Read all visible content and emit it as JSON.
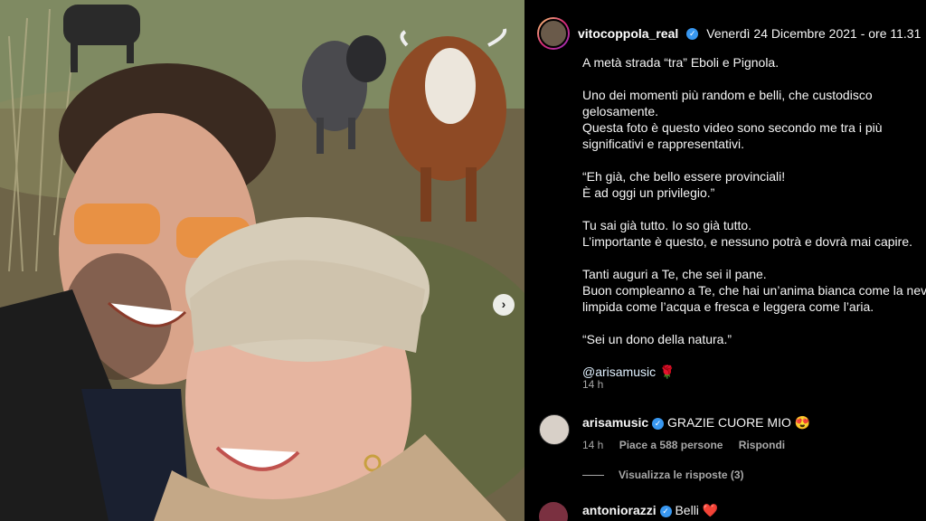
{
  "post": {
    "username": "vitocoppola_real",
    "datetime": "Venerdì 24 Dicembre 2021 - ore 11.31",
    "caption_lines": [
      [
        "A metà strada “tra” Eboli e Pignola."
      ],
      [
        "Uno dei momenti più random e belli, che custodisco",
        "gelosamente.",
        "Questa foto è questo video sono secondo me tra i più",
        "significativi e rappresentativi."
      ],
      [
        "“Eh già, che bello essere provinciali!",
        "È ad oggi un privilegio.”"
      ],
      [
        "Tu sai già tutto. Io so già tutto.",
        "L’importante è questo, e nessuno potrà e dovrà mai capire."
      ],
      [
        "Tanti auguri a Te, che sei il pane.",
        "Buon compleanno a Te, che hai un’anima bianca come la neve,",
        "limpida come l’acqua e fresca e leggera come l’aria."
      ],
      [
        "“Sei un dono della natura.”"
      ]
    ],
    "mention": "@arisamusic",
    "mention_emoji": "🌹",
    "time_ago": "14 h"
  },
  "comments": [
    {
      "username": "arisamusic",
      "text": "GRAZIE CUORE MIO",
      "emoji": "😍",
      "time": "14 h",
      "likes": "Piace a 588 persone",
      "reply": "Rispondi",
      "view_replies": "Visualizza le risposte (3)"
    },
    {
      "username": "antoniorazzi",
      "text": "Belli",
      "emoji": "❤️"
    }
  ],
  "icons": {
    "verified": "verified-badge-icon",
    "next": "chevron-right-icon"
  },
  "colors": {
    "verified": "#3897f0",
    "background": "#000000",
    "secondary_text": "#a8a8a8"
  }
}
